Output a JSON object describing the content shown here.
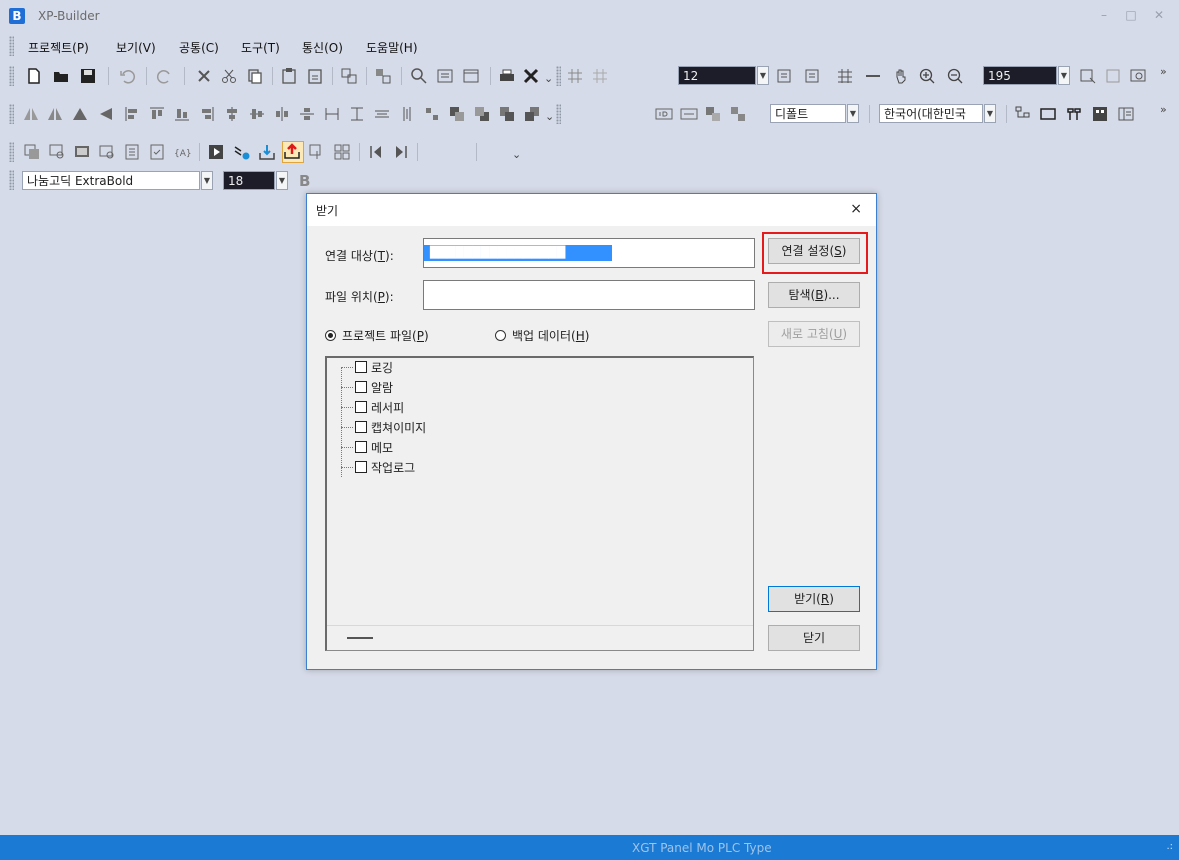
{
  "app": {
    "logo_letter": "B",
    "title": "XP-Builder"
  },
  "window_controls": {
    "minimize": "–",
    "maximize": "□",
    "close": "✕"
  },
  "menu": [
    "프로젝트(P)",
    "보기(V)",
    "공통(C)",
    "도구(T)",
    "통신(O)",
    "도움말(H)"
  ],
  "toolbar": {
    "font_size_value": "12",
    "zoom_value": "195",
    "default_combo": "디폴트",
    "language_combo": "한국어(대한민국",
    "font_name": "나눔고딕 ExtraBold",
    "text_size": "18",
    "more": "»"
  },
  "dialog": {
    "title": "받기",
    "close_glyph": "×",
    "connection_target_label": "연결 대상(",
    "connection_target_key": "T",
    "connection_target_suffix": "):",
    "connection_target_value": "████████████████",
    "file_location_label": "파일 위치(",
    "file_location_key": "P",
    "file_location_suffix": "):",
    "file_location_value": "",
    "connection_settings_button": {
      "text": "연결 설정(",
      "key": "S",
      "suffix": ")"
    },
    "browse_button": {
      "text": "탐색(",
      "key": "B",
      "suffix": ")..."
    },
    "refresh_button": {
      "text": "새로 고침(",
      "key": "U",
      "suffix": ")"
    },
    "radio_project_file": {
      "text": "프로젝트 파일(",
      "key": "P",
      "suffix": ")",
      "checked": true
    },
    "radio_backup_data": {
      "text": "백업 데이터(",
      "key": "H",
      "suffix": ")",
      "checked": false
    },
    "tree_items": [
      "로깅",
      "알람",
      "레서피",
      "캡쳐이미지",
      "메모",
      "작업로그"
    ],
    "receive_button": {
      "text": "받기(",
      "key": "R",
      "suffix": ")"
    },
    "close_button": "닫기"
  },
  "status_bar": {
    "text": "XGT Panel Mo  PLC Type",
    "grip": ".:"
  },
  "colors": {
    "background": "#d6dbe9",
    "status_bar": "#1a7ad4",
    "highlight_border": "#e51a1a",
    "selection": "#3390ff",
    "dialog_border": "#3d7fd1"
  }
}
